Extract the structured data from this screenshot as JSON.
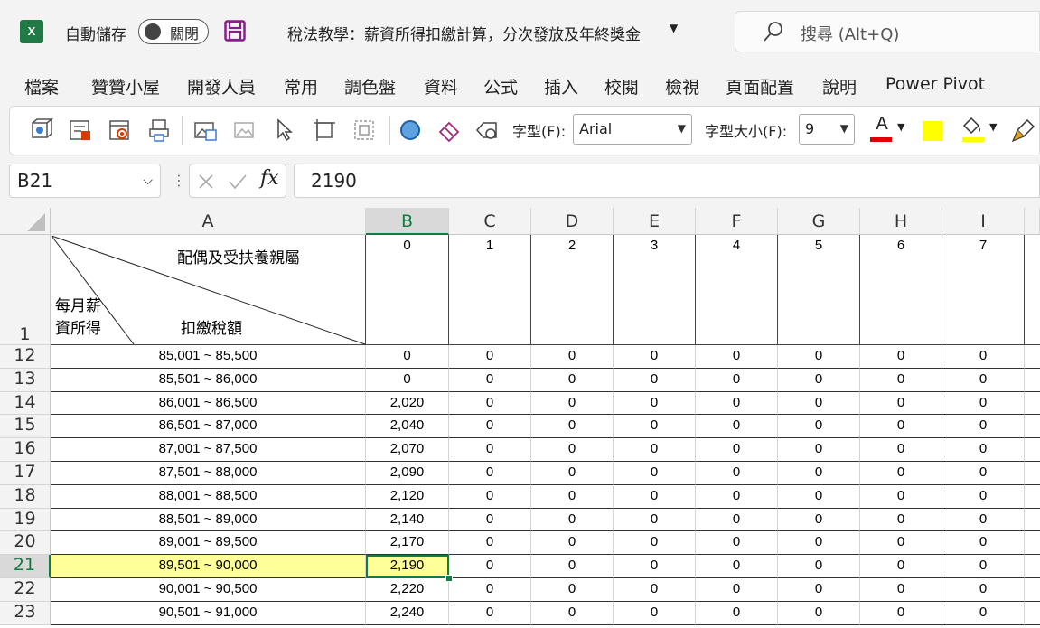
{
  "titlebar": {
    "app_icon": "excel-icon",
    "autosave_label": "自動儲存",
    "autosave_state": "關閉",
    "document_title": "稅法教學：薪資所得扣繳計算，分次發放及年終獎金",
    "search_placeholder": "搜尋 (Alt+Q)"
  },
  "menu": [
    "檔案",
    "贊贊小屋",
    "開發人員",
    "常用",
    "調色盤",
    "資料",
    "公式",
    "插入",
    "校閱",
    "檢視",
    "頁面配置",
    "說明",
    "Power Pivot"
  ],
  "ribbon": {
    "font_label": "字型(F):",
    "font_value": "Arial",
    "size_label": "字型大小(F):",
    "size_value": "9",
    "font_color": "#e00000",
    "fill_color": "#ffff00",
    "highlight_color": "#ffff00"
  },
  "formula_bar": {
    "name_box": "B21",
    "fx_label": "fx",
    "formula": "2190"
  },
  "sheet": {
    "columns": [
      "A",
      "B",
      "C",
      "D",
      "E",
      "F",
      "G",
      "H",
      "I"
    ],
    "selected_column": "B",
    "header_row": {
      "row_number": "1",
      "top_right_label": "配偶及受扶養親屬",
      "left_label_line1": "每月薪",
      "left_label_line2": "資所得",
      "bottom_label": "扣繳稅額",
      "dependents": [
        "0",
        "1",
        "2",
        "3",
        "4",
        "5",
        "6",
        "7"
      ]
    },
    "selected_row": "21",
    "rows": [
      {
        "num": "12",
        "range": "85,001 ~ 85,500",
        "values": [
          "0",
          "0",
          "0",
          "0",
          "0",
          "0",
          "0",
          "0"
        ]
      },
      {
        "num": "13",
        "range": "85,501 ~ 86,000",
        "values": [
          "0",
          "0",
          "0",
          "0",
          "0",
          "0",
          "0",
          "0"
        ]
      },
      {
        "num": "14",
        "range": "86,001 ~ 86,500",
        "values": [
          "2,020",
          "0",
          "0",
          "0",
          "0",
          "0",
          "0",
          "0"
        ]
      },
      {
        "num": "15",
        "range": "86,501 ~ 87,000",
        "values": [
          "2,040",
          "0",
          "0",
          "0",
          "0",
          "0",
          "0",
          "0"
        ]
      },
      {
        "num": "16",
        "range": "87,001 ~ 87,500",
        "values": [
          "2,070",
          "0",
          "0",
          "0",
          "0",
          "0",
          "0",
          "0"
        ]
      },
      {
        "num": "17",
        "range": "87,501 ~ 88,000",
        "values": [
          "2,090",
          "0",
          "0",
          "0",
          "0",
          "0",
          "0",
          "0"
        ]
      },
      {
        "num": "18",
        "range": "88,001 ~ 88,500",
        "values": [
          "2,120",
          "0",
          "0",
          "0",
          "0",
          "0",
          "0",
          "0"
        ]
      },
      {
        "num": "19",
        "range": "88,501 ~ 89,000",
        "values": [
          "2,140",
          "0",
          "0",
          "0",
          "0",
          "0",
          "0",
          "0"
        ]
      },
      {
        "num": "20",
        "range": "89,001 ~ 89,500",
        "values": [
          "2,170",
          "0",
          "0",
          "0",
          "0",
          "0",
          "0",
          "0"
        ]
      },
      {
        "num": "21",
        "range": "89,501 ~ 90,000",
        "values": [
          "2,190",
          "0",
          "0",
          "0",
          "0",
          "0",
          "0",
          "0"
        ]
      },
      {
        "num": "22",
        "range": "90,001 ~ 90,500",
        "values": [
          "2,220",
          "0",
          "0",
          "0",
          "0",
          "0",
          "0",
          "0"
        ]
      },
      {
        "num": "23",
        "range": "90,501 ~ 91,000",
        "values": [
          "2,240",
          "0",
          "0",
          "0",
          "0",
          "0",
          "0",
          "0"
        ]
      }
    ],
    "highlight_color": "#ffff99",
    "selection_color": "#107c41"
  }
}
